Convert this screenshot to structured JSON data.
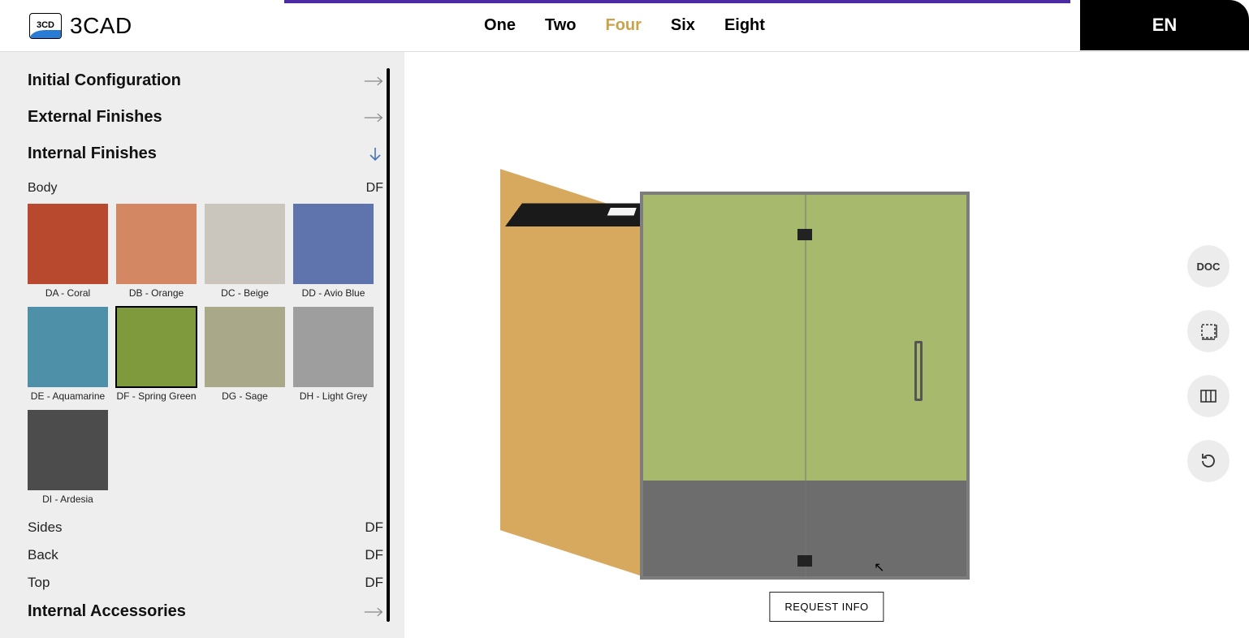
{
  "header": {
    "logo_badge": "3CD",
    "logo_text": "3CAD",
    "nav": [
      "One",
      "Two",
      "Four",
      "Six",
      "Eight"
    ],
    "nav_active_index": 2,
    "lang": "EN"
  },
  "sidebar": {
    "sections": {
      "initial": "Initial Configuration",
      "external": "External Finishes",
      "internal": "Internal Finishes",
      "accessories": "Internal Accessories"
    },
    "body_label": "Body",
    "body_value": "DF",
    "swatches": [
      {
        "code": "DA",
        "label": "DA - Coral",
        "color": "#b8492f",
        "selected": false
      },
      {
        "code": "DB",
        "label": "DB - Orange",
        "color": "#d48763",
        "selected": false
      },
      {
        "code": "DC",
        "label": "DC - Beige",
        "color": "#cbc6bd",
        "selected": false
      },
      {
        "code": "DD",
        "label": "DD - Avio Blue",
        "color": "#5f74ac",
        "selected": false
      },
      {
        "code": "DE",
        "label": "DE - Aquamarine",
        "color": "#4d90a8",
        "selected": false
      },
      {
        "code": "DF",
        "label": "DF - Spring Green",
        "color": "#7e9a3d",
        "selected": true
      },
      {
        "code": "DG",
        "label": "DG - Sage",
        "color": "#a9a98a",
        "selected": false
      },
      {
        "code": "DH",
        "label": "DH - Light Grey",
        "color": "#9e9e9e",
        "selected": false
      },
      {
        "code": "DI",
        "label": "DI - Ardesia",
        "color": "#4c4c4c",
        "selected": false
      }
    ],
    "props": [
      {
        "label": "Sides",
        "value": "DF"
      },
      {
        "label": "Back",
        "value": "DF"
      },
      {
        "label": "Top",
        "value": "DF"
      }
    ]
  },
  "viewport": {
    "request_button": "REQUEST INFO",
    "fabs": {
      "doc": "DOC",
      "dimensions_icon": "dimensions",
      "views_icon": "views",
      "reset_icon": "reset"
    }
  }
}
